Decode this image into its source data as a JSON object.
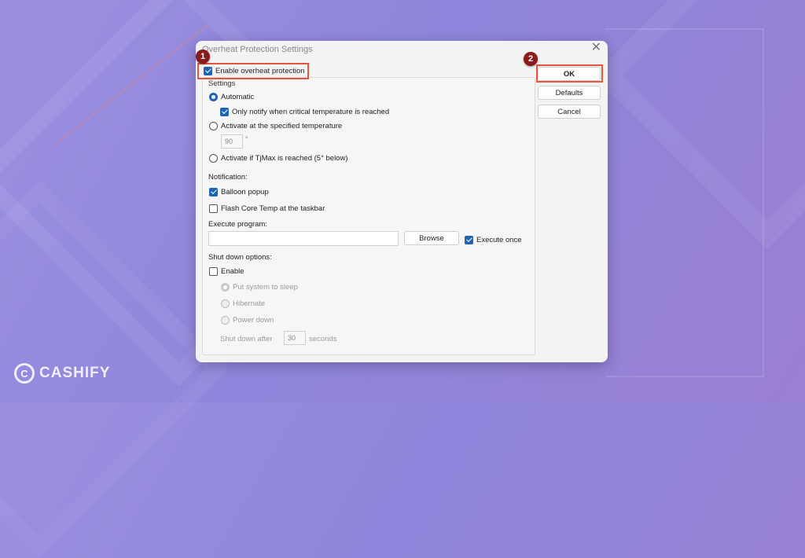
{
  "dialog": {
    "title": "Overheat Protection Settings",
    "close_label": "✕",
    "enable_protection": {
      "label": "Enable overheat protection",
      "checked": true
    },
    "settings_group_label": "Settings",
    "automatic": {
      "label": "Automatic",
      "selected": true
    },
    "only_notify": {
      "label": "Only notify when critical temperature is reached",
      "checked": true
    },
    "activate_specified": {
      "label": "Activate at the specified temperature",
      "selected": false
    },
    "temperature_value": "90",
    "temperature_unit": "°",
    "activate_tjmax": {
      "label": "Activate if TjMax is reached (5° below)",
      "selected": false
    },
    "notification_label": "Notification:",
    "balloon_popup": {
      "label": "Balloon popup",
      "checked": true
    },
    "flash_core_temp": {
      "label": "Flash Core Temp at the taskbar",
      "checked": false
    },
    "execute_program_label": "Execute program:",
    "execute_program_value": "",
    "browse_label": "Browse",
    "execute_once": {
      "label": "Execute once",
      "checked": true
    },
    "shutdown_label": "Shut down options:",
    "shutdown_enable": {
      "label": "Enable",
      "checked": false
    },
    "put_to_sleep": {
      "label": "Put system to sleep",
      "selected": true
    },
    "hibernate": {
      "label": "Hibernate",
      "selected": false
    },
    "power_down": {
      "label": "Power down",
      "selected": false
    },
    "shutdown_after_label": "Shut down after",
    "shutdown_after_value": "30",
    "shutdown_after_unit": "seconds",
    "ok_label": "OK",
    "defaults_label": "Defaults",
    "cancel_label": "Cancel"
  },
  "markers": {
    "step1": "1",
    "step2": "2"
  },
  "brand": {
    "logo_letter": "C",
    "name": "CASHIFY"
  },
  "colors": {
    "highlight": "#e4573e",
    "marker": "#8b1a1a",
    "accent": "#1f64b3"
  }
}
